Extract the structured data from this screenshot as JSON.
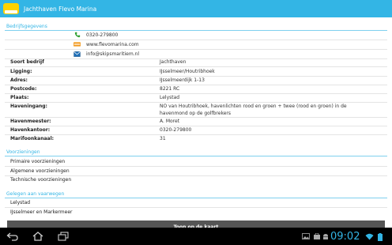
{
  "app": {
    "title": "Jachthaven Flevo Marina",
    "logo_icon": "marina-logo-icon"
  },
  "sections": {
    "bedrijfsgegevens": "Bedrijfsgegevens",
    "voorzieningen": "Voorzieningen",
    "gelegen": "Gelegen aan vaarwegen"
  },
  "contacts": [
    {
      "icon": "phone-icon",
      "value": "0320-279800"
    },
    {
      "icon": "www-icon",
      "value": "www.flevomarina.com"
    },
    {
      "icon": "email-icon",
      "value": "info@skipsmaritiem.nl"
    }
  ],
  "fields": [
    {
      "label": "Soort bedrijf",
      "value": "Jachthaven"
    },
    {
      "label": "Ligging:",
      "value": "IJsselmeer/Houtribhoek"
    },
    {
      "label": "Adres:",
      "value": "IJsselmeerdijk 1-13"
    },
    {
      "label": "Postcode:",
      "value": "8221 RC"
    },
    {
      "label": "Plaats:",
      "value": "Lelystad"
    },
    {
      "label": "Haveningang:",
      "value": "NO van Houtribhoek, havenlichten rood en groen + twee (rood en groen) in de havenmond op de golfbrekers"
    },
    {
      "label": "Havenmeester:",
      "value": "A. Moret"
    },
    {
      "label": "Havenkantoor:",
      "value": "0320-279800"
    },
    {
      "label": "Marifoonkanaal:",
      "value": "31"
    }
  ],
  "voorzieningen": [
    "Primaire voorzieningen",
    "Algemene voorzieningen",
    "Technische voorzieningen"
  ],
  "vaarwegen": [
    "Lelystad",
    "IJsselmeer en Markermeer"
  ],
  "map_button": "Toon op de kaart",
  "status": {
    "clock": "09:02"
  },
  "colors": {
    "accent": "#33b5e5",
    "button": "#555555",
    "navbar": "#000000"
  }
}
